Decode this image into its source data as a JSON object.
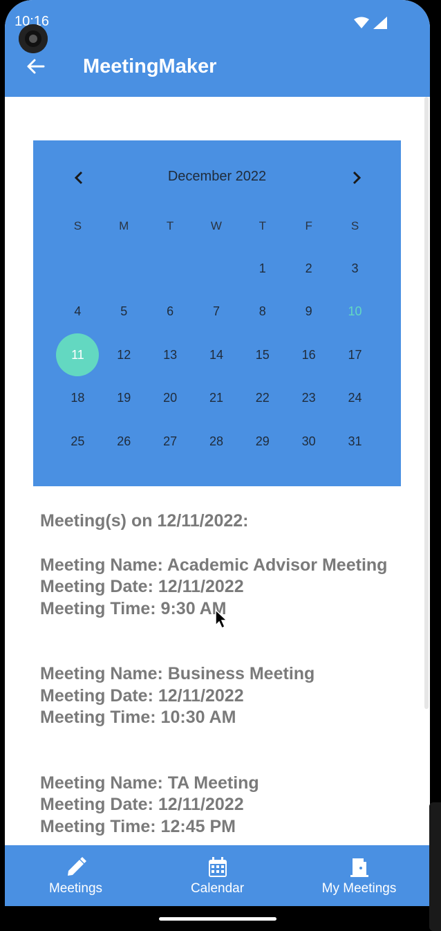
{
  "status_bar": {
    "time": "10:16"
  },
  "app_bar": {
    "title": "MeetingMaker"
  },
  "calendar": {
    "month_label": "December 2022",
    "days_of_week": [
      "S",
      "M",
      "T",
      "W",
      "T",
      "F",
      "S"
    ],
    "weeks": [
      [
        "",
        "",
        "",
        "",
        "1",
        "2",
        "3"
      ],
      [
        "4",
        "5",
        "6",
        "7",
        "8",
        "9",
        "10"
      ],
      [
        "11",
        "12",
        "13",
        "14",
        "15",
        "16",
        "17"
      ],
      [
        "18",
        "19",
        "20",
        "21",
        "22",
        "23",
        "24"
      ],
      [
        "25",
        "26",
        "27",
        "28",
        "29",
        "30",
        "31"
      ]
    ],
    "today": "10",
    "selected": "11",
    "colors": {
      "background": "#4a90e2",
      "accent": "#63d8c1"
    }
  },
  "meetings": {
    "heading": "Meeting(s) on 12/11/2022:",
    "items": [
      {
        "name": "Meeting Name: Academic Advisor Meeting",
        "date": "Meeting Date: 12/11/2022",
        "time": "Meeting Time: 9:30 AM"
      },
      {
        "name": "Meeting Name: Business Meeting",
        "date": "Meeting Date: 12/11/2022",
        "time": "Meeting Time: 10:30 AM"
      },
      {
        "name": "Meeting Name: TA Meeting",
        "date": "Meeting Date: 12/11/2022",
        "time": "Meeting Time: 12:45 PM"
      }
    ]
  },
  "bottom_nav": {
    "items": [
      {
        "label": "Meetings",
        "icon": "pencil-icon"
      },
      {
        "label": "Calendar",
        "icon": "calendar-icon"
      },
      {
        "label": "My Meetings",
        "icon": "door-icon"
      }
    ]
  }
}
